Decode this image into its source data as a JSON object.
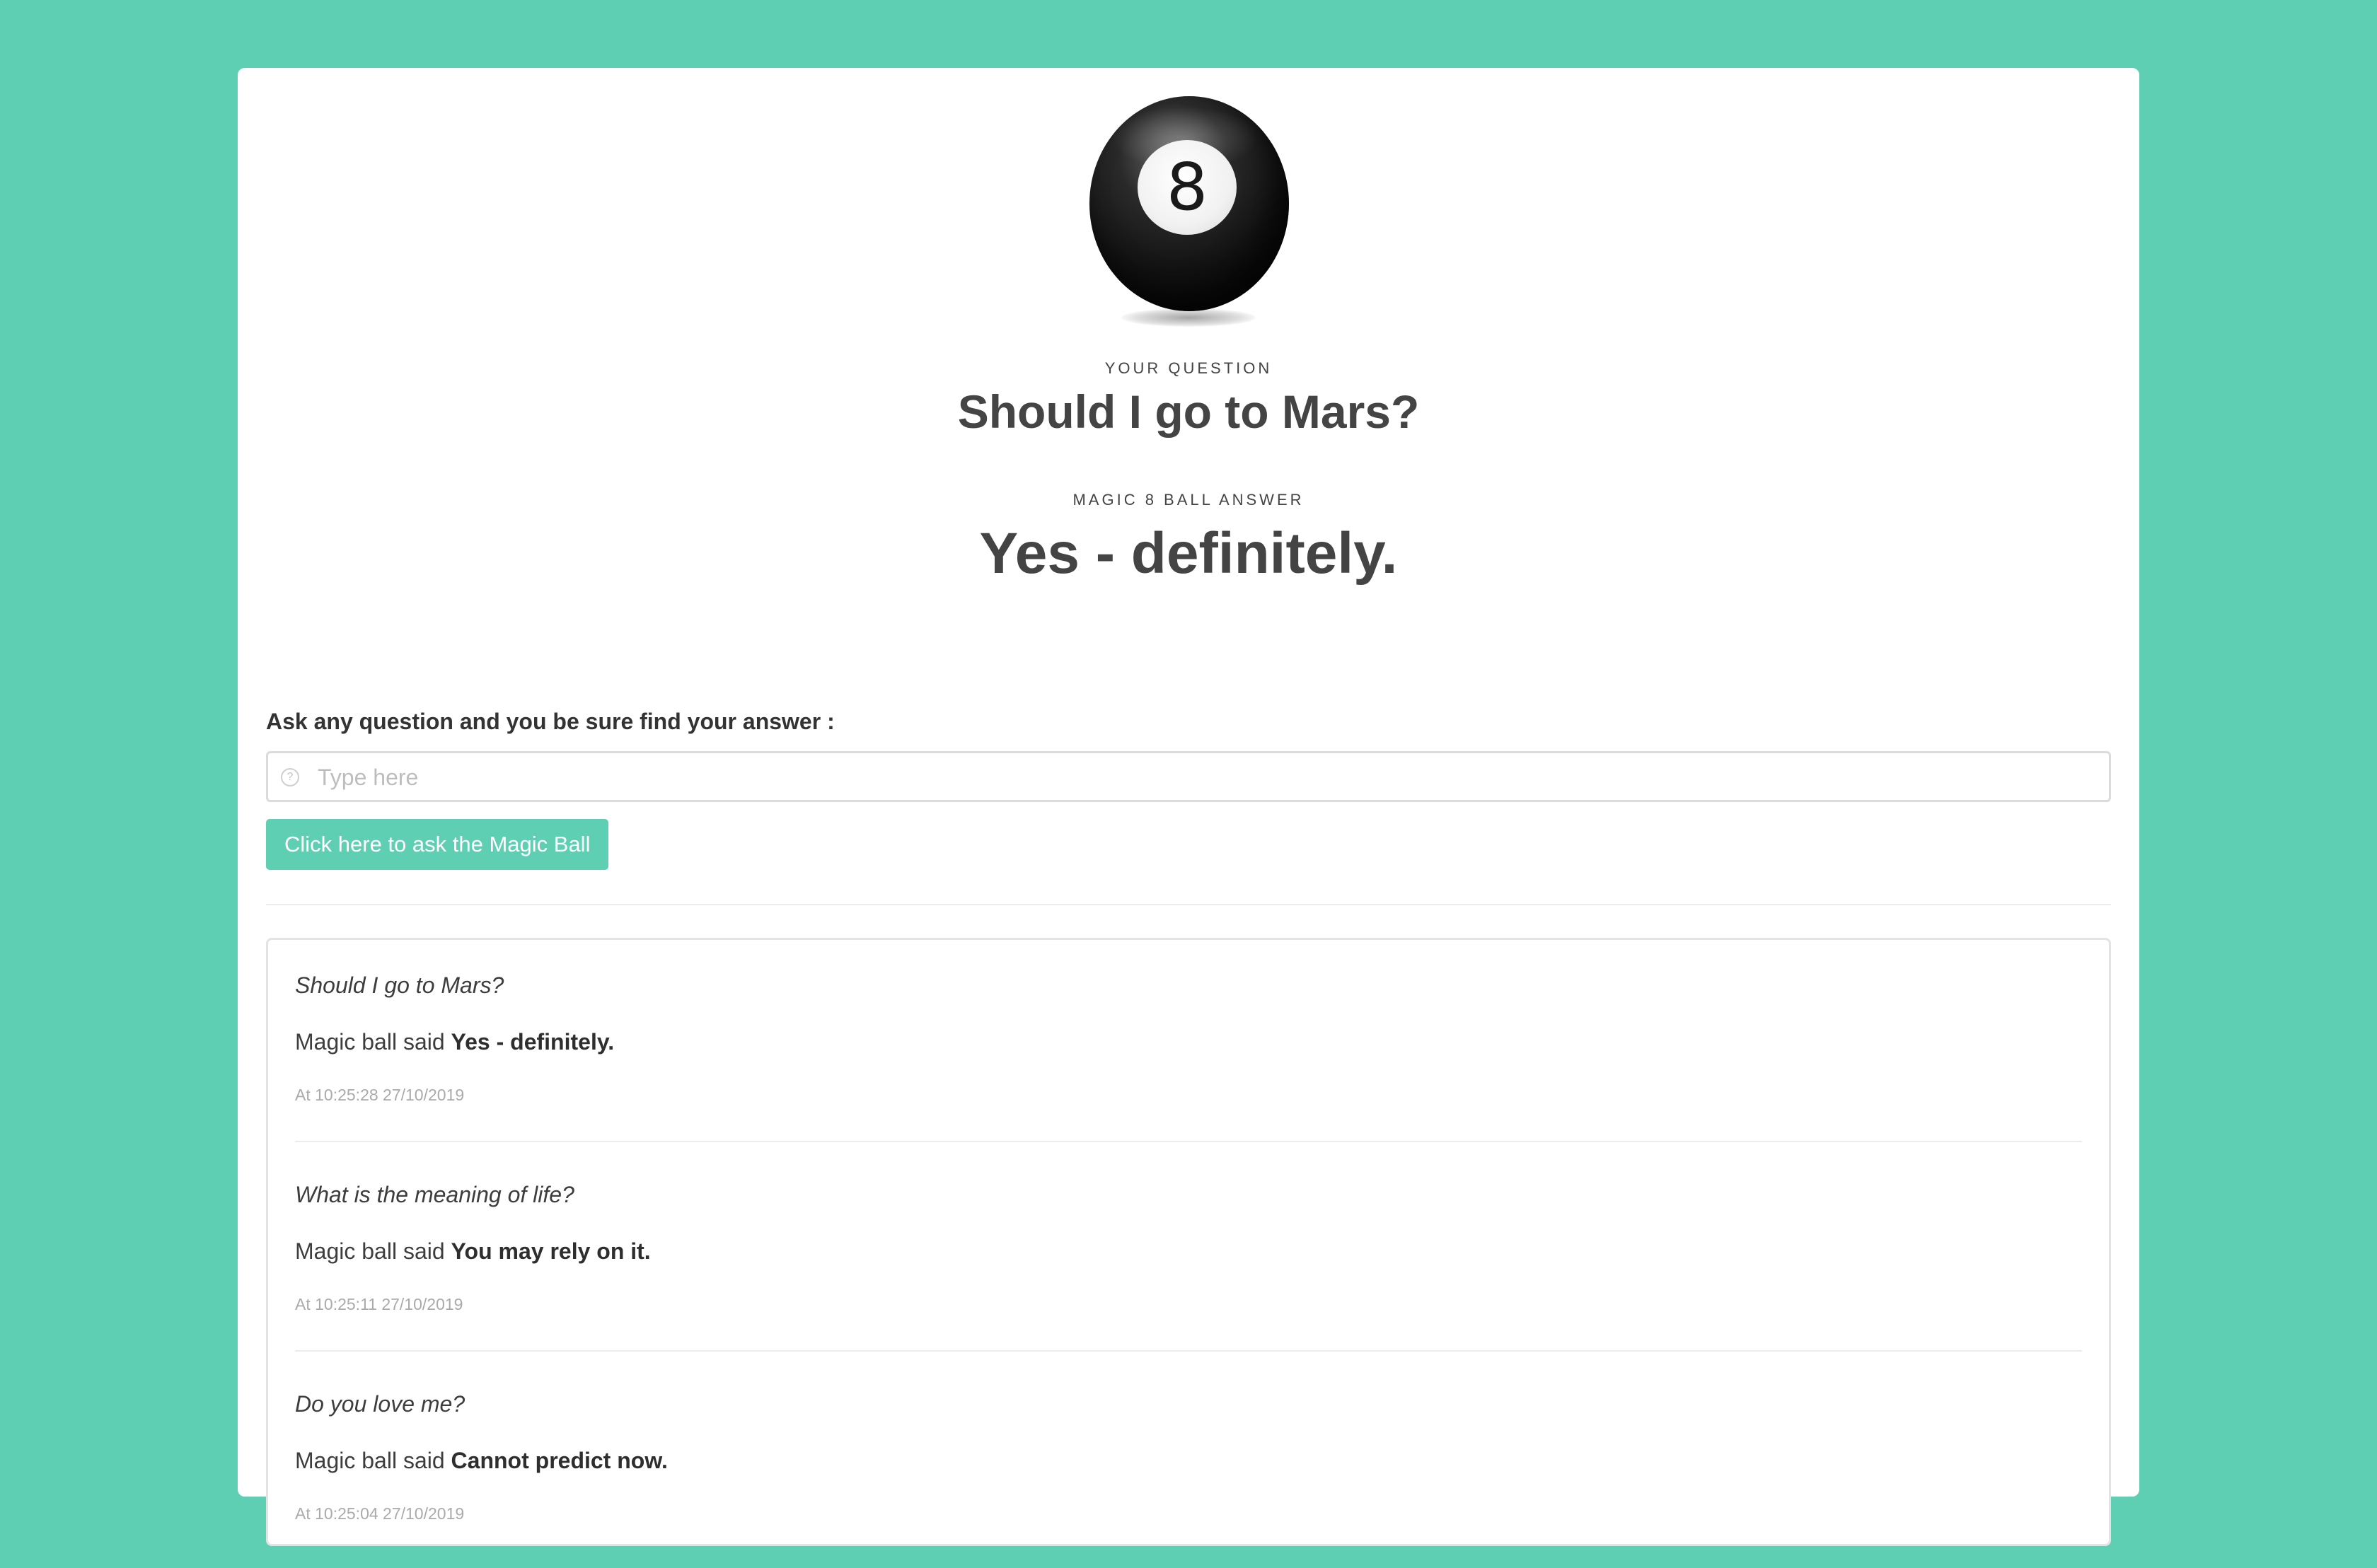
{
  "current": {
    "question_label": "YOUR QUESTION",
    "question": "Should I go to Mars?",
    "answer_label": "MAGIC 8 BALL ANSWER",
    "answer": "Yes - definitely."
  },
  "ball": {
    "number": "8",
    "icon": "magic-8-ball-image"
  },
  "form": {
    "label": "Ask any question and you be sure find your answer :",
    "placeholder": "Type here",
    "value": "",
    "input_icon": "question-circle-icon",
    "button_label": "Click here to ask the Magic Ball"
  },
  "history": {
    "said_prefix": "Magic ball said",
    "entries": [
      {
        "question": "Should I go to Mars?",
        "answer": "Yes - definitely.",
        "time": "At 10:25:28 27/10/2019"
      },
      {
        "question": "What is the meaning of life?",
        "answer": "You may rely on it.",
        "time": "At 10:25:11 27/10/2019"
      },
      {
        "question": "Do you love me?",
        "answer": "Cannot predict now.",
        "time": "At 10:25:04 27/10/2019"
      }
    ]
  },
  "colors": {
    "background": "#5ecfb3",
    "accent": "#5ecfb3",
    "card": "#ffffff",
    "text": "#444444"
  }
}
